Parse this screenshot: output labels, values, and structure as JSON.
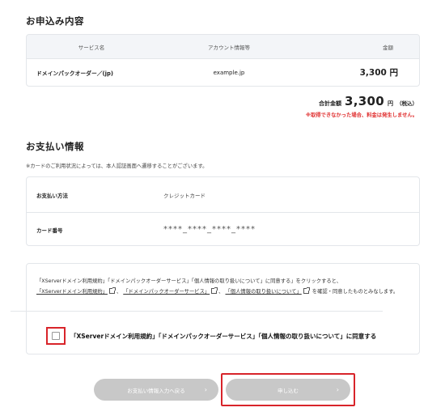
{
  "order": {
    "title": "お申込み内容",
    "headers": [
      "サービス名",
      "アカウント情報等",
      "金額"
    ],
    "row": [
      "ドメインパックオーダー／(jp)",
      "example.jp",
      "3,300 円"
    ],
    "total_label": "合計金額",
    "total_amount": "3,300",
    "total_unit": "円",
    "total_tax": "（税込）",
    "warning": "※取得できなかった場合、料金は発生しません。"
  },
  "payment": {
    "title": "お支払い情報",
    "note": "※カードのご利用状況によっては、本人認証画面へ遷移することがございます。",
    "method_label": "お支払い方法",
    "method_value": "クレジットカード",
    "card_label": "カード番号",
    "card_value": "****_****_****_****"
  },
  "terms": {
    "intro": "「XServerドメイン利用規約」「ドメインパックオーダーサービス」「個人情報の取り扱いについて」に同意する」をクリックすると、",
    "link1": "「XServerドメイン利用規約」",
    "sep1": "、",
    "link2": "「ドメインパックオーダーサービス」",
    "sep2": "、",
    "link3": "「個人情報の取り扱いについて」",
    "tail": "を確認・同意したものとみなします。",
    "agree_label": "「XServerドメイン利用規約」「ドメインパックオーダーサービス」「個人情報の取り扱いについて」に同意する"
  },
  "buttons": {
    "back": "お支払い情報入力へ戻る",
    "submit": "申し込む",
    "arrow": "›"
  },
  "colors": {
    "highlight": "#d8242a",
    "warning": "#e03030",
    "button_disabled": "#c8c8c8"
  }
}
